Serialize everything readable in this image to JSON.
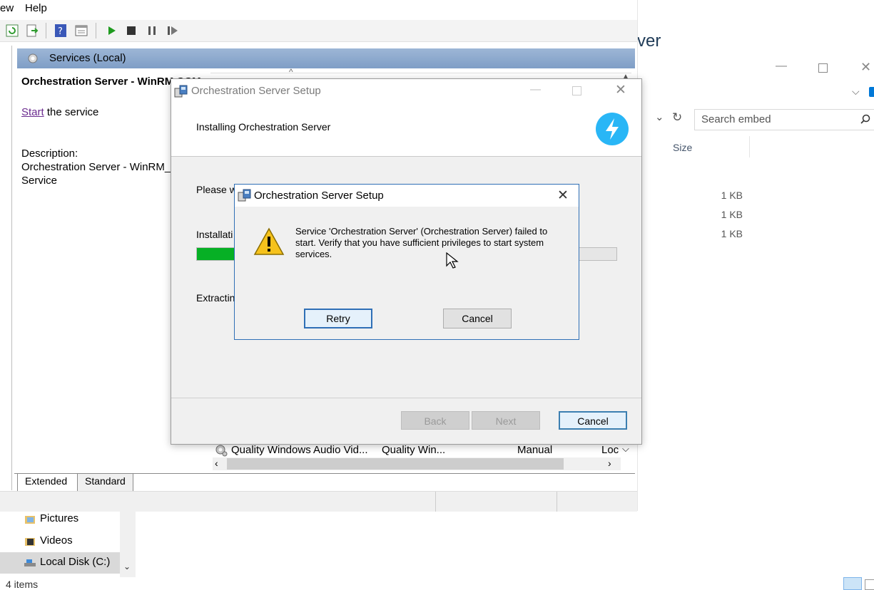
{
  "explorer": {
    "title_fragment": "ver",
    "search_placeholder": "Search embed",
    "column_size": "Size",
    "sizes": [
      "1 KB",
      "1 KB",
      "1 KB"
    ],
    "nav": [
      {
        "label": "Pictures",
        "icon": "pictures-folder-icon"
      },
      {
        "label": "Videos",
        "icon": "videos-folder-icon"
      },
      {
        "label": "Local Disk (C:)",
        "icon": "drive-icon"
      }
    ],
    "status_items": "4 items"
  },
  "mmc": {
    "menu": [
      "ew",
      "Help"
    ],
    "pane_title": "Services (Local)",
    "service_title": "Orchestration Server - WinRM CCM",
    "start_link": "Start",
    "start_suffix": " the service",
    "description_label": "Description:",
    "description_line1": "Orchestration Server - WinRM_S",
    "description_line2": "Service",
    "row": {
      "name": "Quality Windows Audio Vid...",
      "description": "Quality Win...",
      "startup": "Manual",
      "logon": "Loc"
    },
    "tabs": [
      "Extended",
      "Standard"
    ]
  },
  "wizard": {
    "title": "Orchestration Server Setup",
    "heading": "Installing Orchestration Server",
    "please_wait": "Please w",
    "install_label": "Installati",
    "extracting": "Extractin",
    "progress": 0.1,
    "buttons": {
      "back": "Back",
      "next": "Next",
      "cancel": "Cancel"
    }
  },
  "dialog": {
    "title": "Orchestration Server Setup",
    "message": "Service 'Orchestration Server' (Orchestration Server) failed to start.  Verify that you have sufficient privileges to start system services.",
    "retry": "Retry",
    "cancel": "Cancel"
  },
  "colors": {
    "accent": "#0078d7",
    "progress": "#06b025",
    "header": "#7f9ec6",
    "badge": "#29b6f6"
  }
}
